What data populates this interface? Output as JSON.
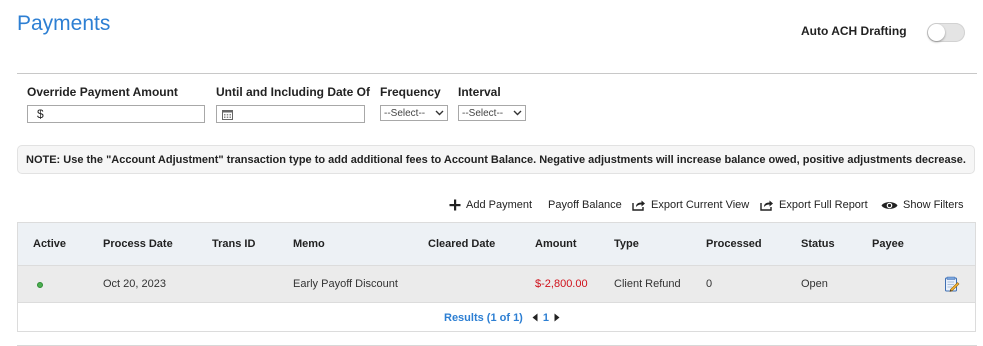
{
  "header": {
    "title": "Payments",
    "auto_ach_label": "Auto ACH Drafting",
    "auto_ach_enabled": false
  },
  "filters": {
    "override_amount_label": "Override Payment Amount",
    "override_amount_value": "$",
    "until_date_label": "Until and Including Date Of",
    "until_date_value": "",
    "frequency_label": "Frequency",
    "frequency_value": "--Select--",
    "interval_label": "Interval",
    "interval_value": "--Select--"
  },
  "note": "NOTE: Use the \"Account Adjustment\" transaction type to add additional fees to Account Balance. Negative adjustments will increase balance owed, positive adjustments decrease.",
  "actions": {
    "add_payment": "Add Payment",
    "payoff_balance": "Payoff Balance",
    "export_current": "Export Current View",
    "export_full": "Export Full Report",
    "show_filters": "Show Filters"
  },
  "table": {
    "columns": {
      "active": "Active",
      "process_date": "Process Date",
      "trans_id": "Trans ID",
      "memo": "Memo",
      "cleared_date": "Cleared Date",
      "amount": "Amount",
      "type": "Type",
      "processed": "Processed",
      "status": "Status",
      "payee": "Payee"
    },
    "rows": [
      {
        "active": true,
        "process_date": "Oct 20, 2023",
        "trans_id": "",
        "memo": "Early Payoff Discount",
        "cleared_date": "",
        "amount": "$-2,800.00",
        "type": "Client Refund",
        "processed": "0",
        "status": "Open",
        "payee": ""
      }
    ]
  },
  "pagination": {
    "results_text": "Results (1 of 1)",
    "current_page": "1"
  },
  "colors": {
    "accent": "#2d7fd3",
    "negative_amount": "#d0111b",
    "active_dot": "#4caf50",
    "header_bg": "#edf1f5",
    "row_bg": "#ebebeb"
  }
}
